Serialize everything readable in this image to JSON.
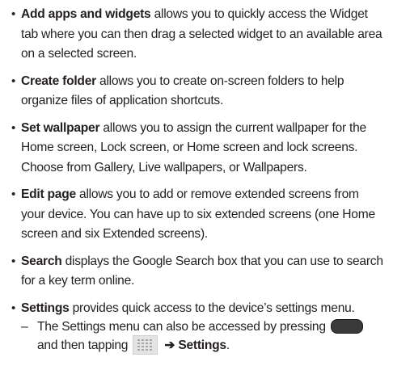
{
  "items": [
    {
      "term": "Add apps and widgets",
      "text": " allows you to quickly access the Widget tab where you can then drag a selected widget to an available area on a selected screen."
    },
    {
      "term": "Create folder",
      "text": " allows you to create on-screen folders to help organize files of application shortcuts."
    },
    {
      "term": "Set wallpaper",
      "text": " allows you to assign the current wallpaper for the Home screen, Lock screen, or Home screen and lock screens. Choose from Gallery, Live wallpapers, or Wallpapers."
    },
    {
      "term": "Edit page",
      "text": " allows you to add or remove extended screens from your device. You can have up to six extended screens (one Home screen and six Extended screens)."
    },
    {
      "term": "Search",
      "text": " displays the Google Search box that you can use to search for a key term online."
    },
    {
      "term": "Settings",
      "text": " provides quick access to the device’s settings menu."
    }
  ],
  "bullet": "•",
  "sub_note": {
    "dash": "–",
    "text_before": "The Settings menu can also be accessed by pressing",
    "text_middle": "and then tapping",
    "arrow": "➔",
    "settings_label": "Settings",
    "period": "."
  },
  "icons": {
    "home_key": "home-key-icon",
    "apps_grid": "apps-grid-icon"
  }
}
